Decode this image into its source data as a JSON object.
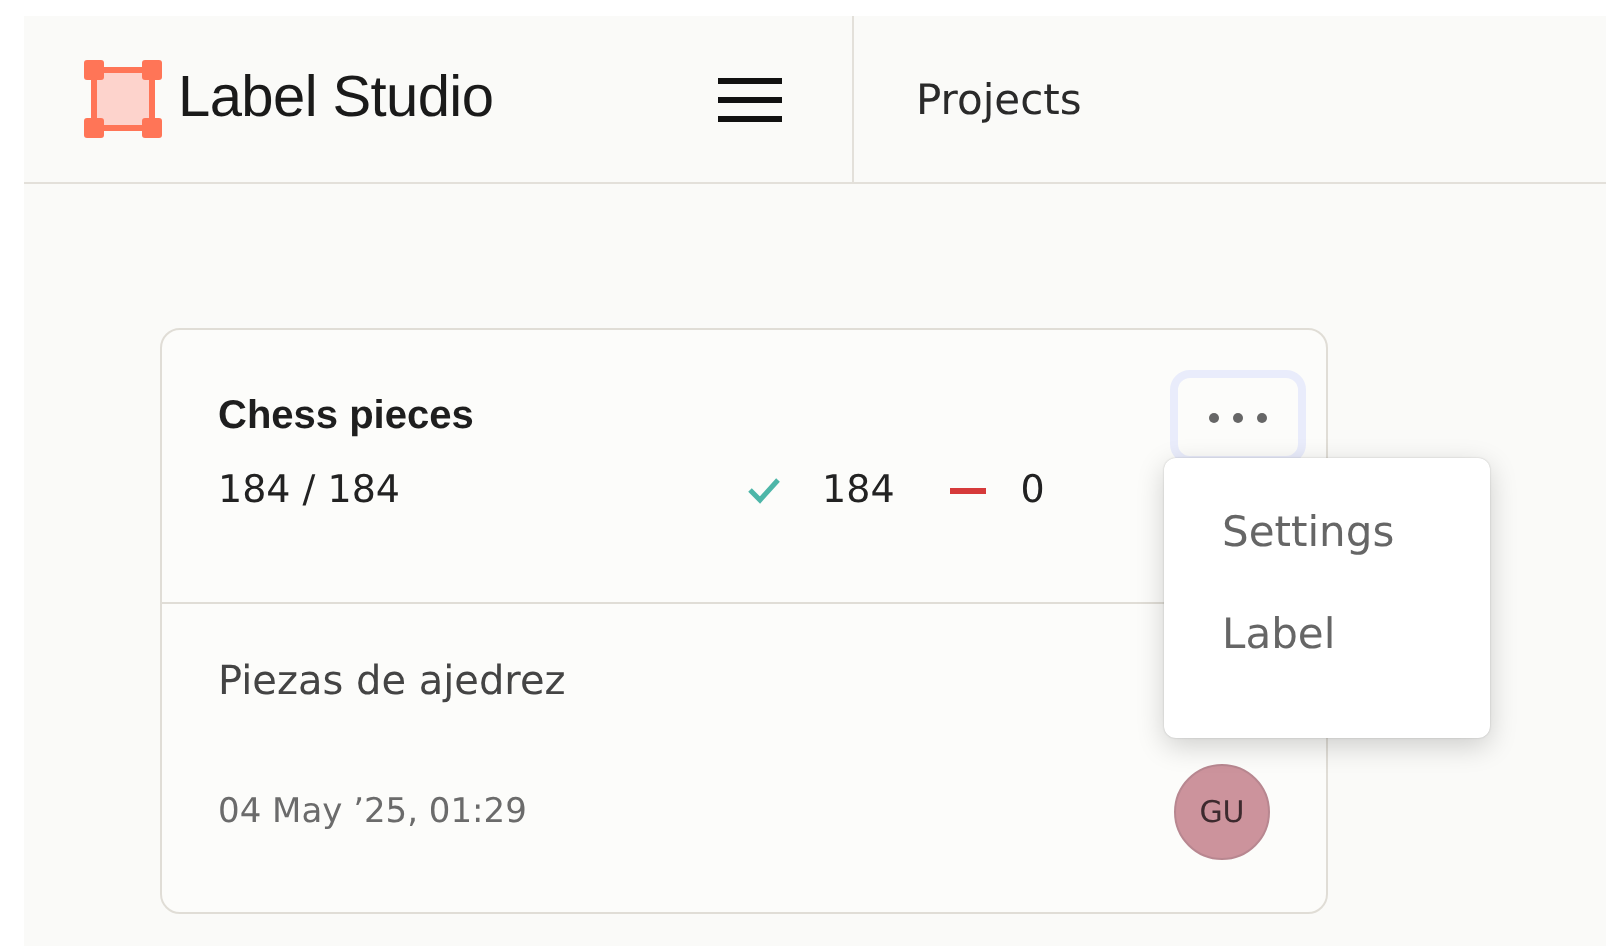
{
  "header": {
    "brand": "Label Studio",
    "breadcrumb": "Projects"
  },
  "project": {
    "title": "Chess pieces",
    "progress": "184 / 184",
    "completed": "184",
    "skipped": "0",
    "description": "Piezas de ajedrez",
    "created": "04 May ’25, 01:29",
    "avatar": {
      "initials": "GU",
      "color": "#cc939c"
    }
  },
  "menu": {
    "items": [
      {
        "label": "Settings"
      },
      {
        "label": "Label"
      }
    ]
  }
}
